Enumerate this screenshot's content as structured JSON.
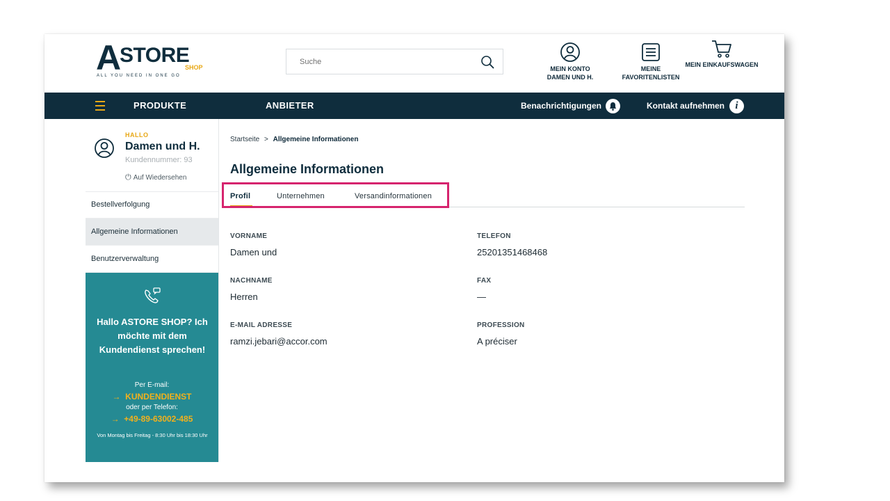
{
  "header": {
    "logo": {
      "letter": "A",
      "word": "STORE",
      "sub": "SHOP",
      "tagline": "ALL YOU NEED IN ONE GO"
    },
    "search": {
      "placeholder": "Suche",
      "value": ""
    },
    "account": {
      "line1": "MEIN KONTO",
      "line2": "DAMEN UND H."
    },
    "favorites": {
      "line1": "MEINE",
      "line2": "FAVORITENLISTEN"
    },
    "cart": {
      "label": "MEIN EINKAUFSWAGEN"
    }
  },
  "nav": {
    "products": "PRODUKTE",
    "vendors": "ANBIETER",
    "notifications": "Benachrichtigungen",
    "contact": "Kontakt aufnehmen"
  },
  "sidebar": {
    "hello": "HALLO",
    "name": "Damen und H.",
    "customer_number": "Kundennummer: 93",
    "logout": "Auf Wiedersehen",
    "items": [
      {
        "label": "Bestellverfolgung",
        "active": false
      },
      {
        "label": "Allgemeine Informationen",
        "active": true
      },
      {
        "label": "Benutzerverwaltung",
        "active": false
      }
    ],
    "help": {
      "title": "Hallo ASTORE SHOP? Ich möchte mit dem Kundendienst sprechen!",
      "by_email": "Per E-mail:",
      "email_link": "KUNDENDIENST",
      "by_phone": "oder per Telefon:",
      "phone_link": "+49-89-63002-485",
      "hours": "Von Montag bis Freitag - 8:30 Uhr bis 18:30 Uhr"
    }
  },
  "breadcrumb": {
    "home": "Startseite",
    "separator": ">",
    "current": "Allgemeine Informationen"
  },
  "main": {
    "title": "Allgemeine Informationen",
    "tabs": [
      {
        "label": "Profil",
        "active": true
      },
      {
        "label": "Unternehmen",
        "active": false
      },
      {
        "label": "Versandinformationen",
        "active": false
      }
    ],
    "fields": {
      "first_name": {
        "label": "VORNAME",
        "value": "Damen und"
      },
      "phone": {
        "label": "TELEFON",
        "value": "25201351468468"
      },
      "last_name": {
        "label": "NACHNAME",
        "value": "Herren"
      },
      "fax": {
        "label": "FAX",
        "value": "—"
      },
      "email": {
        "label": "E-MAIL ADRESSE",
        "value": "ramzi.jebari@accor.com"
      },
      "profession": {
        "label": "PROFESSION",
        "value": "A préciser"
      }
    }
  },
  "colors": {
    "navy": "#0f2d3d",
    "accent": "#e8a816",
    "teal": "#258a93",
    "highlight": "#d6246e"
  },
  "icons": [
    "search-icon",
    "user-circle-icon",
    "list-icon",
    "cart-icon",
    "menu-icon",
    "bell-icon",
    "info-icon",
    "power-icon",
    "phone-chat-icon",
    "arrow-right-icon"
  ]
}
